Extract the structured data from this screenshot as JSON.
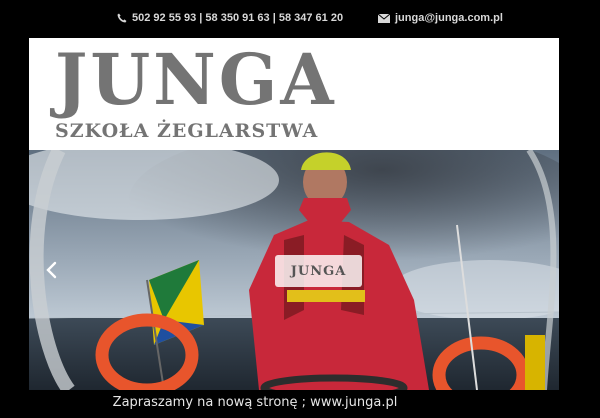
{
  "topbar": {
    "phones": "502 92 55 93 | 58 350 91 63 | 58 347 61 20",
    "email": "junga@junga.com.pl",
    "phone_icon": "phone-icon",
    "mail_icon": "envelope-icon"
  },
  "header": {
    "logo_title": "JUNGA",
    "logo_subtitle": "SZKOŁA ŻEGLARSTWA"
  },
  "slider": {
    "badge_text": "JUNGA",
    "prev_icon": "chevron-left-icon"
  },
  "caption": {
    "text": "Zapraszamy na nową stronę ; www.junga.pl"
  },
  "colors": {
    "background": "#000000",
    "logo_gray": "#747474",
    "jacket_red": "#c8283a"
  }
}
